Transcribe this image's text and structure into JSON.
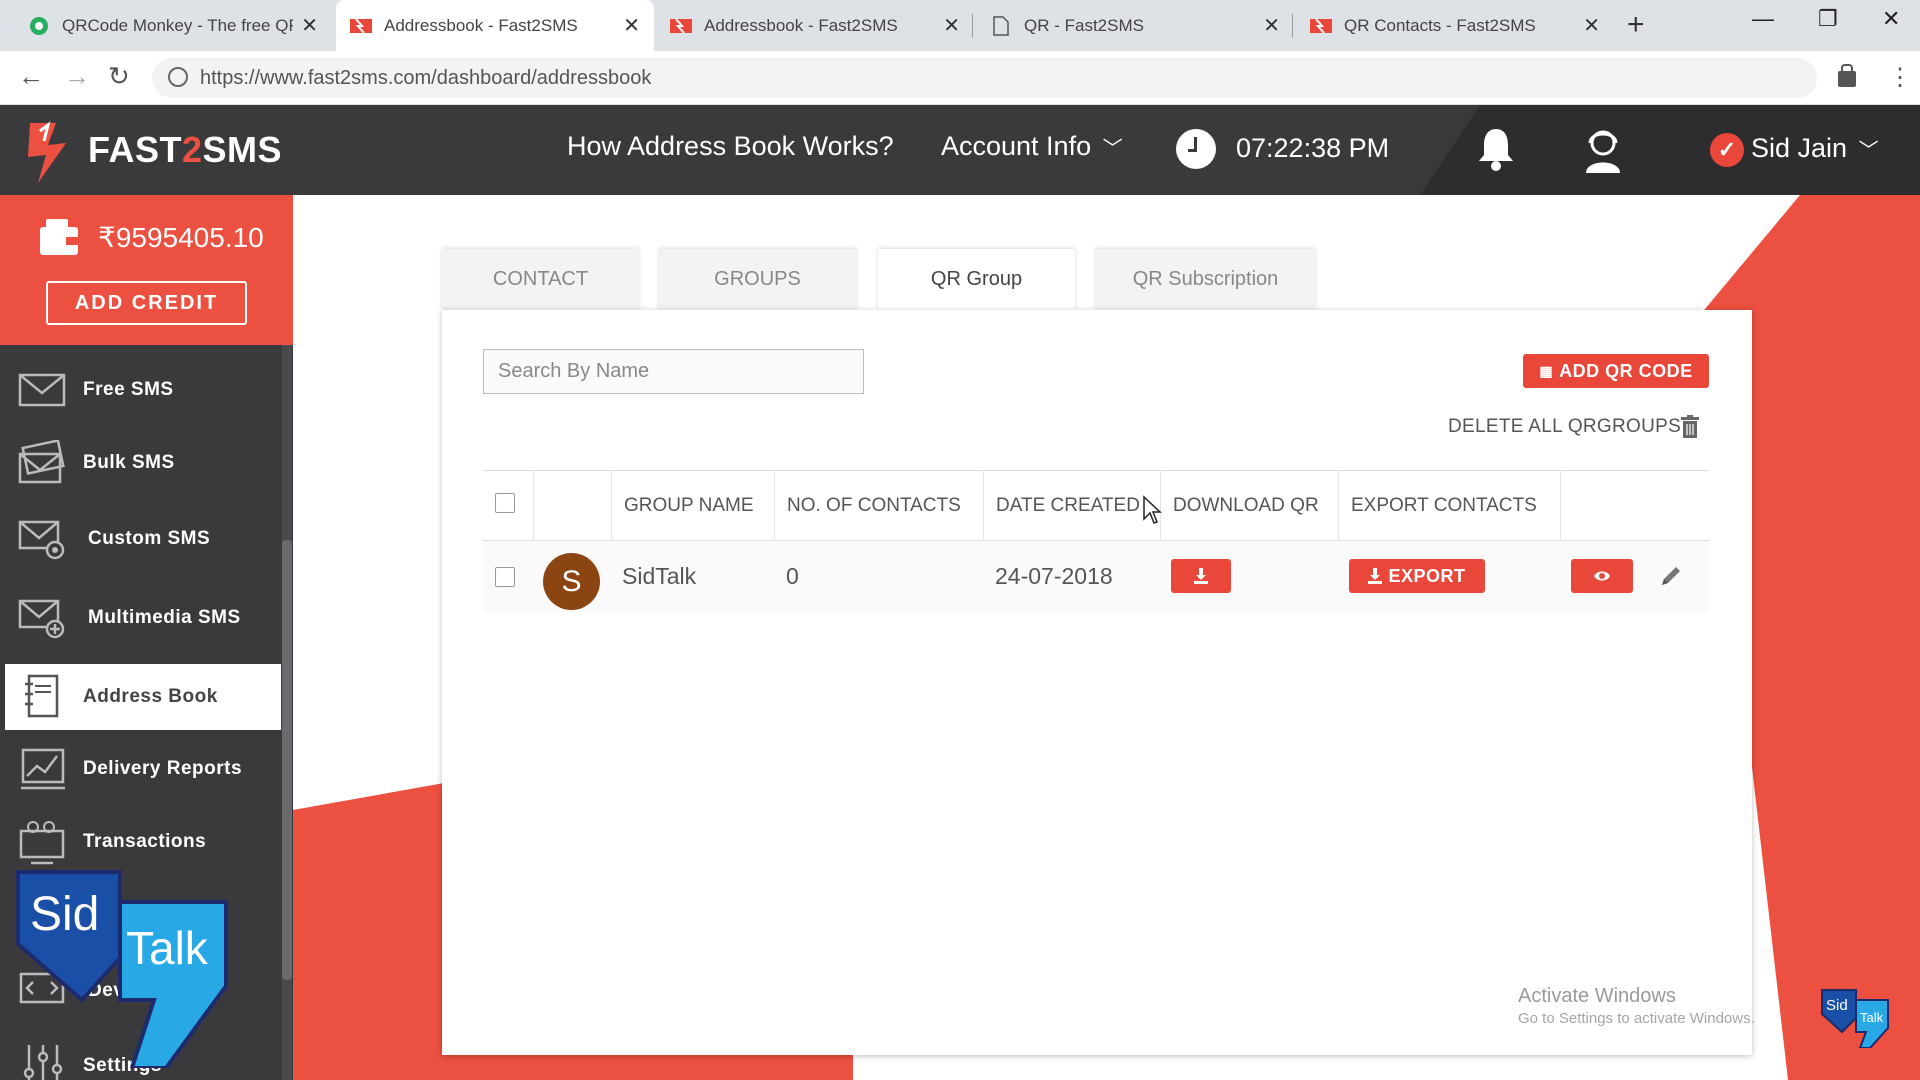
{
  "browser": {
    "tabs": [
      {
        "title": "QRCode Monkey - The free QR",
        "active": false
      },
      {
        "title": "Addressbook - Fast2SMS",
        "active": true
      },
      {
        "title": "Addressbook - Fast2SMS",
        "active": false
      },
      {
        "title": "QR - Fast2SMS",
        "active": false
      },
      {
        "title": "QR Contacts - Fast2SMS",
        "active": false
      }
    ],
    "url": "https://www.fast2sms.com/dashboard/addressbook"
  },
  "header": {
    "logo_pre": "FAST",
    "logo_two": "2",
    "logo_post": "SMS",
    "how_link": "How Address Book Works?",
    "account_info": "Account Info",
    "time": "07:22:38 PM",
    "user_name": "Sid Jain"
  },
  "sidebar": {
    "balance": "₹9595405.10",
    "add_credit": "ADD CREDIT",
    "items": [
      {
        "label": "Free SMS",
        "icon": "envelope-icon"
      },
      {
        "label": "Bulk SMS",
        "icon": "envelopes-icon"
      },
      {
        "label": "Custom SMS",
        "icon": "envelope-gear-icon"
      },
      {
        "label": "Multimedia SMS",
        "icon": "envelope-plus-icon"
      },
      {
        "label": "Address Book",
        "icon": "address-book-icon"
      },
      {
        "label": "Delivery Reports",
        "icon": "chart-icon"
      },
      {
        "label": "Transactions",
        "icon": "monitor-coins-icon"
      },
      {
        "label": "Dev API",
        "icon": "code-monitor-icon"
      },
      {
        "label": "Settings",
        "icon": "sliders-icon"
      }
    ],
    "overlay_logo": {
      "top": "Sid",
      "bottom": "Talk"
    }
  },
  "main": {
    "tabs": [
      "CONTACT",
      "GROUPS",
      "QR Group",
      "QR Subscription"
    ],
    "active_tab": "QR Group",
    "search_placeholder": "Search By Name",
    "add_qr_button": "ADD QR CODE",
    "delete_all": "DELETE ALL QRGROUPS",
    "table": {
      "headers": [
        "GROUP NAME",
        "NO. OF CONTACTS",
        "DATE CREATED",
        "DOWNLOAD QR",
        "EXPORT CONTACTS"
      ],
      "rows": [
        {
          "avatar": "S",
          "group_name": "SidTalk",
          "contacts": "0",
          "date_created": "24-07-2018",
          "export_label": "EXPORT"
        }
      ]
    }
  },
  "watermark": {
    "line1": "Activate Windows",
    "line2": "Go to Settings to activate Windows."
  },
  "colors": {
    "brand_red": "#e8473a",
    "header_dark": "#3a3a3d"
  }
}
